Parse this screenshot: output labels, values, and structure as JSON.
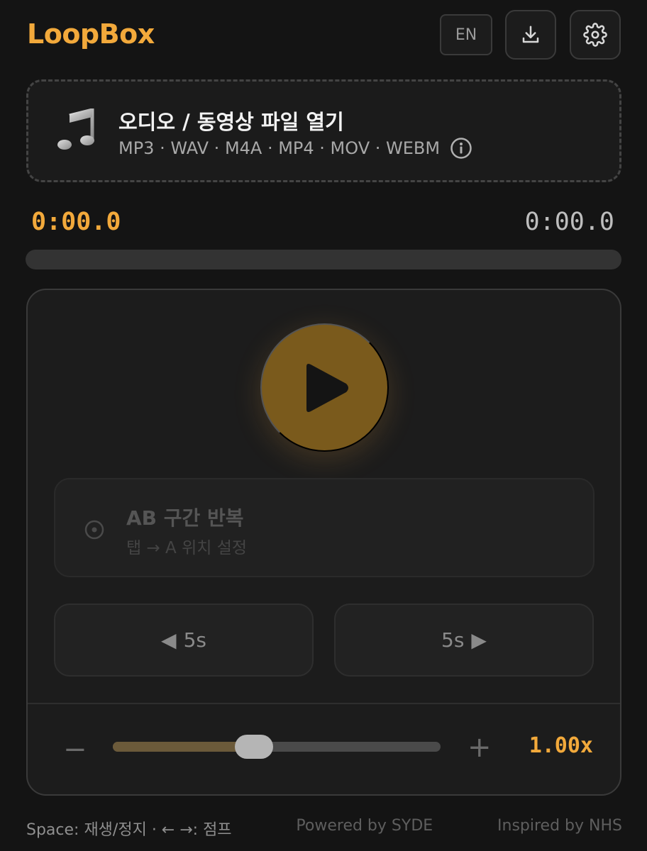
{
  "header": {
    "brand": "LoopBox",
    "lang_label": "EN",
    "download_icon": "download-icon",
    "settings_icon": "gear-icon"
  },
  "file": {
    "icon": "music-note-icon",
    "title": "오디오 / 동영상 파일 열기",
    "formats": "MP3 · WAV · M4A · MP4 · MOV · WEBM",
    "info_icon": "info-icon"
  },
  "time": {
    "current": "0:00.0",
    "total": "0:00.0",
    "progress": 0
  },
  "player": {
    "play_icon": "play-icon",
    "ab": {
      "title": "AB 구간 반복",
      "subtitle": "탭 → A 위치 설정",
      "icon": "target-icon"
    },
    "skip_back": {
      "arrow": "◀",
      "label": "5s"
    },
    "skip_forward": {
      "arrow": "▶",
      "label": "5s"
    },
    "speed": {
      "minus": "−",
      "plus": "+",
      "value": "1.00x",
      "slider_fraction": 0.43
    }
  },
  "footer": {
    "shortcuts": "Space: 재생/정지 · ← →: 점프",
    "powered": "Powered by SYDE",
    "inspired": "Inspired by NHS"
  },
  "colors": {
    "accent": "#f2a93b",
    "background": "#141414",
    "panel": "#1c1c1c",
    "play_button": "#7a5a1c"
  }
}
